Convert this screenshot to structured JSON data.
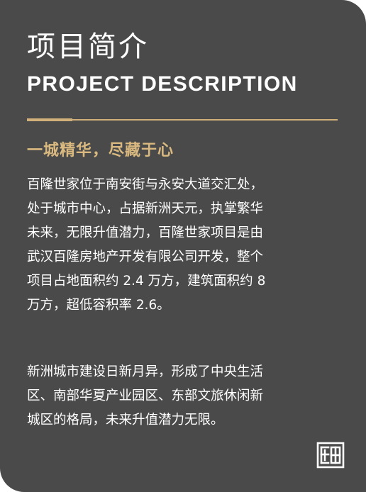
{
  "card": {
    "title": "项目简介",
    "subtitle": "PROJECT DESCRIPTION",
    "slogan": "一城精华，尽藏于心",
    "paragraph1_lines": [
      "百隆世家位于南安街与永安大道交汇处，",
      "处于城市中心，占据新洲天元，执掌繁华",
      "未来，无限升值潜力，百隆世家项目是由",
      "武汉百隆房地产开发有限公司开发，整个",
      "项目占地面积约 2.4 万方，建筑面积约 8",
      "万方，超低容积率 2.6。"
    ],
    "paragraph2_lines": [
      "新洲城市建设日新月异，形成了中央生活",
      "区、南部华夏产业园区、东部文旅休闲新",
      "城区的格局，未来升值潜力无限。"
    ],
    "seal_icon": "seal-logo-icon"
  },
  "colors": {
    "background": "#4a4a4a",
    "accent_gold": "#d1b07a",
    "text": "#ffffff"
  }
}
